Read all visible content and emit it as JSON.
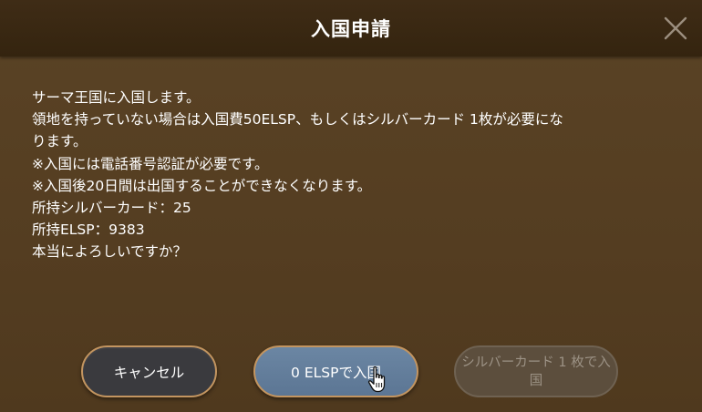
{
  "dialog": {
    "title": "入国申請",
    "close_label": "×"
  },
  "message": {
    "lines": [
      "サーマ王国に入国します。",
      "領地を持っていない場合は入国費50ELSP、もしくはシルバーカード 1枚が必要にな",
      "ります。",
      "※入国には電話番号認証が必要です。",
      "※入国後20日間は出国することができなくなります。",
      "所持シルバーカード：25",
      "所持ELSP：9383",
      "本当によろしいですか？"
    ]
  },
  "buttons": {
    "cancel": "キャンセル",
    "elsp": "0 ELSPで入国",
    "silver": "シルバーカード 1 枚で入国",
    "silver_enabled": false
  },
  "colors": {
    "background": "#553f22",
    "titlebar": "#3a2812",
    "button_border": "#c39560",
    "primary_button": "#617b98",
    "cancel_button": "#3a3a3e"
  }
}
